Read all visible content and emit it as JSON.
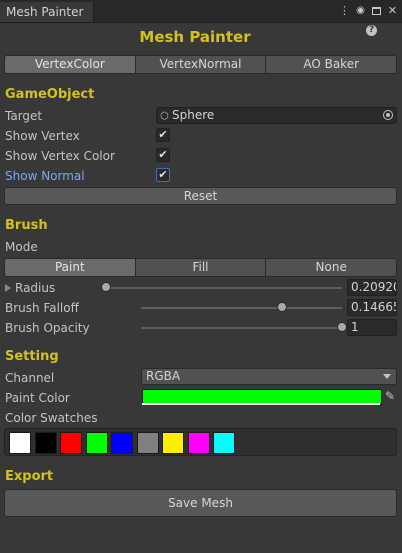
{
  "window": {
    "tab_title": "Mesh Painter",
    "title": "Mesh Painter"
  },
  "colors": {
    "accent": "#d4c21c",
    "link": "#7ea6f0"
  },
  "mode_tabs": [
    {
      "label": "VertexColor",
      "selected": true
    },
    {
      "label": "VertexNormal",
      "selected": false
    },
    {
      "label": "AO Baker",
      "selected": false
    }
  ],
  "gameobject": {
    "header": "GameObject",
    "target_label": "Target",
    "target_value": "Sphere",
    "show_vertex_label": "Show Vertex",
    "show_vertex_checked": true,
    "show_vertex_color_label": "Show Vertex Color",
    "show_vertex_color_checked": true,
    "show_normal_label": "Show Normal",
    "show_normal_checked": true,
    "reset_label": "Reset"
  },
  "brush": {
    "header": "Brush",
    "mode_label": "Mode",
    "modes": [
      {
        "label": "Paint",
        "selected": true
      },
      {
        "label": "Fill",
        "selected": false
      },
      {
        "label": "None",
        "selected": false
      }
    ],
    "radius_label": "Radius",
    "radius_value": "0.20920",
    "radius_fraction": 0.0,
    "falloff_label": "Brush Falloff",
    "falloff_value": "0.14665",
    "falloff_fraction": 0.7,
    "opacity_label": "Brush Opacity",
    "opacity_value": "1",
    "opacity_fraction": 1.0
  },
  "setting": {
    "header": "Setting",
    "channel_label": "Channel",
    "channel_value": "RGBA",
    "paint_color_label": "Paint Color",
    "paint_color": "#00ff00",
    "swatches_label": "Color Swatches",
    "swatches": [
      "#ffffff",
      "#000000",
      "#ff0000",
      "#00ff00",
      "#0000ff",
      "#808080",
      "#ffee00",
      "#ff00ff",
      "#00ffff"
    ]
  },
  "export": {
    "header": "Export",
    "save_label": "Save Mesh"
  }
}
